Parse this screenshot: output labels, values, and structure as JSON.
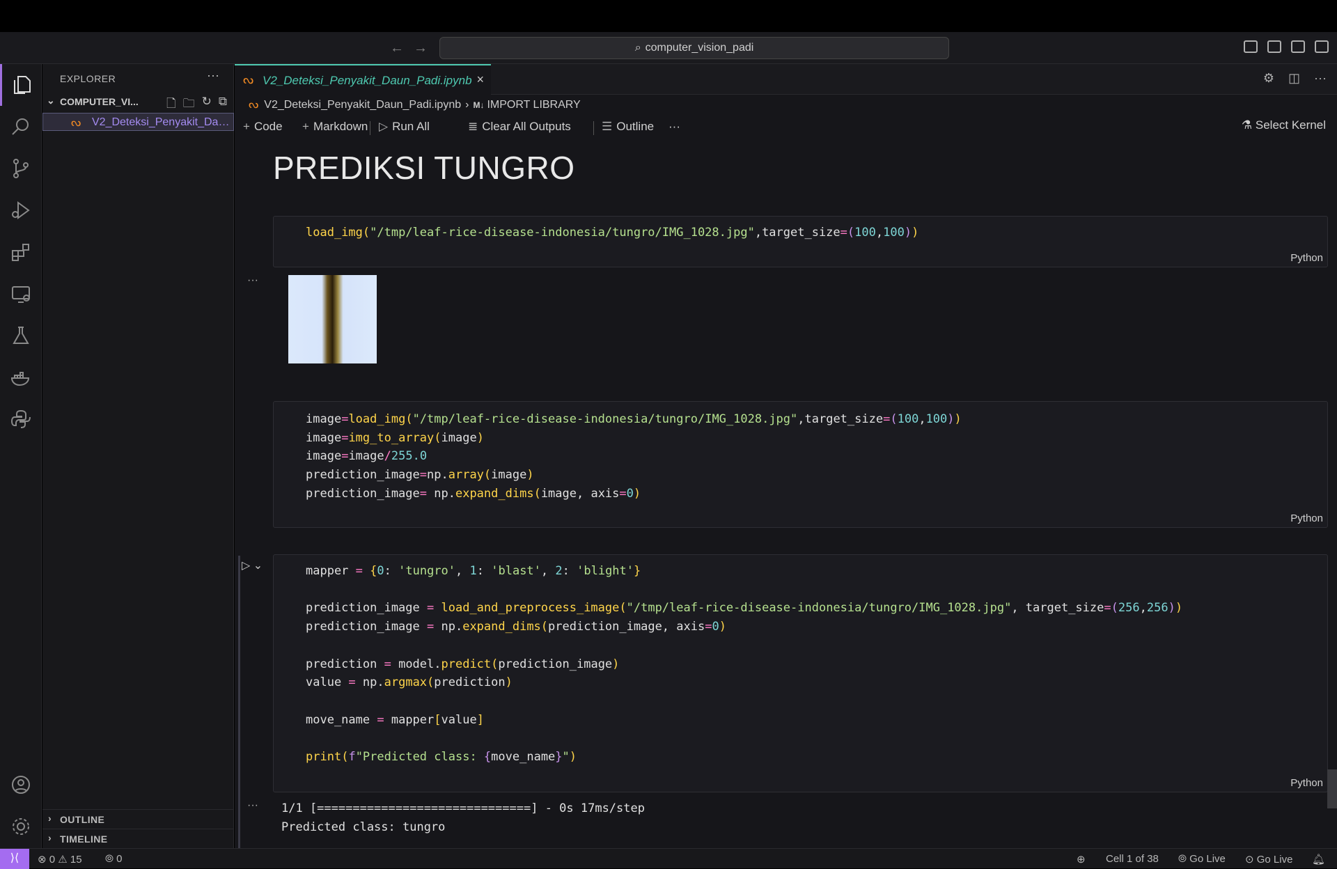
{
  "titlebar": {
    "search_text": "computer_vision_padi"
  },
  "sidebar": {
    "title": "EXPLORER",
    "folder": "COMPUTER_VI...",
    "file": "V2_Deteksi_Penyakit_Daun_Padi.ipynb",
    "sections": [
      "OUTLINE",
      "TIMELINE"
    ]
  },
  "tab": {
    "label": "V2_Deteksi_Penyakit_Daun_Padi.ipynb"
  },
  "breadcrumb": {
    "file": "V2_Deteksi_Penyakit_Daun_Padi.ipynb",
    "md_badge": "M↓",
    "section": "IMPORT LIBRARY"
  },
  "toolbar": {
    "code": "Code",
    "markdown": "Markdown",
    "run_all": "Run All",
    "clear_outputs": "Clear All Outputs",
    "outline": "Outline",
    "more": "···",
    "kernel": "Select Kernel"
  },
  "heading": "PREDIKSI TUNGRO",
  "cells": {
    "lang": "Python",
    "output1": "1/1 [==============================] - 0s 17ms/step",
    "output2": "Predicted class: tungro"
  },
  "statusbar": {
    "errors": "0",
    "warnings": "15",
    "ports": "0",
    "cell_pos": "Cell 1 of 38",
    "golive1": "Go Live",
    "golive2": "Go Live"
  },
  "colors": {
    "accent": "#a46cf0",
    "tab_active": "#4ec9b0",
    "jupyter": "#f08a24"
  }
}
